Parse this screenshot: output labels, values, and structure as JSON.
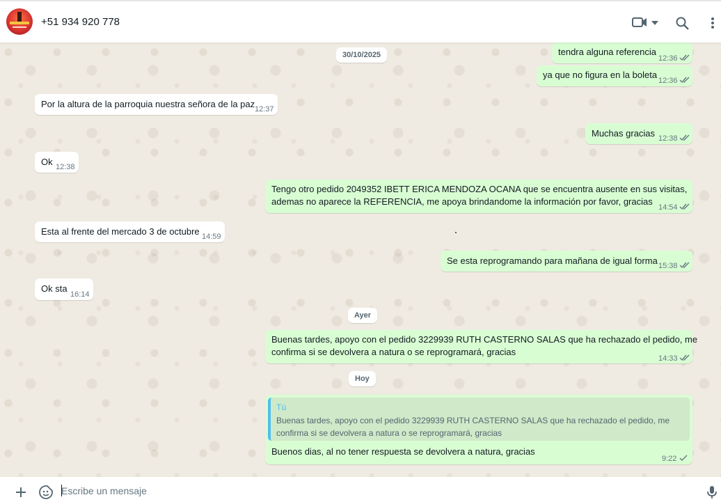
{
  "header": {
    "contact_name": "+51 934 920 778",
    "icons": [
      "video-call-icon",
      "chevron-down-icon",
      "search-icon",
      "more-options-icon"
    ]
  },
  "chat": {
    "dates": [
      "30/10/2025",
      "Ayer",
      "Hoy"
    ],
    "messages": [
      {
        "dir": "out",
        "text": "tendra alguna referencia",
        "time": "12:36",
        "status": "read"
      },
      {
        "dir": "out",
        "text": "ya que no figura en la boleta",
        "time": "12:36",
        "status": "read"
      },
      {
        "dir": "in",
        "text": "Por la altura de la parroquia nuestra señora de la paz",
        "time": "12:37"
      },
      {
        "dir": "out",
        "text": "Muchas gracias",
        "time": "12:38",
        "status": "read"
      },
      {
        "dir": "in",
        "text": "Ok",
        "time": "12:38"
      },
      {
        "dir": "out",
        "text_line1": "Tengo otro pedido 2049352 IBETT ERICA MENDOZA OCANA que se encuentra ausente en sus visitas,",
        "text_line2": "ademas no aparece la REFERENCIA, me apoya brindandome la información por favor, gracias",
        "time": "14:54",
        "status": "read"
      },
      {
        "dir": "in",
        "text": "Esta al frente del mercado 3 de octubre",
        "time": "14:59"
      },
      {
        "dir": "out",
        "text": "Se esta reprogramando para mañana de igual forma",
        "time": "15:38",
        "status": "read"
      },
      {
        "dir": "in",
        "text": "Ok sta",
        "time": "16:14"
      },
      {
        "dir": "out",
        "text_line1": "Buenas tardes, apoyo con el pedido 3229939 RUTH CASTERNO SALAS que ha rechazado el pedido, me",
        "text_line2": "confirma si se devolvera a natura o se reprogramará, gracias",
        "time": "14:33",
        "status": "read"
      },
      {
        "dir": "out",
        "quote_author": "Tú",
        "quote_line1": "Buenas tardes, apoyo con el pedido 3229939 RUTH CASTERNO SALAS que ha rechazado el pedido, me",
        "quote_line2": "confirma si se devolvera a natura o se reprogramará, gracias",
        "text": "Buenos dias, al no tener respuesta se devolvera a natura, gracias",
        "time": "9:22",
        "status": "sent"
      }
    ]
  },
  "composer": {
    "placeholder": "Escribe un mensaje",
    "icons": [
      "attach-plus-icon",
      "sticker-icon",
      "microphone-icon"
    ]
  },
  "colors": {
    "chat_background": "#efeae2",
    "incoming_bubble": "#ffffff",
    "outgoing_bubble": "#d9fdd3",
    "read_tick": "#53bdeb",
    "quote_accent": "#53bdeb"
  }
}
